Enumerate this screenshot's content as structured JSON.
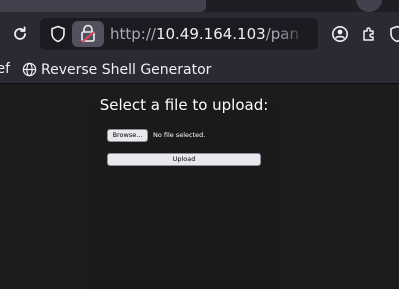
{
  "browser": {
    "url_scheme": "http://",
    "url_host": "10.49.164.103",
    "url_path_visible": "/pan",
    "icons": {
      "reload": "reload-icon",
      "tracking_protection": "shield-icon",
      "permissions": "lock-warning-icon",
      "bookmark_star": "star-icon",
      "account": "account-icon",
      "extensions": "puzzle-icon"
    }
  },
  "bookmarks": {
    "partial_label": "ef",
    "items": [
      {
        "label": "Reverse Shell Generator",
        "icon": "globe-icon"
      }
    ]
  },
  "upload_form": {
    "title": "Select a file to upload:",
    "browse_label": "Browse...",
    "file_status": "No file selected.",
    "submit_label": "Upload"
  },
  "colors": {
    "toolbar_bg": "#2b2a33",
    "urlbar_bg": "#1c1b22",
    "page_bg": "#1c1c1c",
    "permission_icon_accent": "#e0445a",
    "button_bg": "#e9e9ed"
  }
}
